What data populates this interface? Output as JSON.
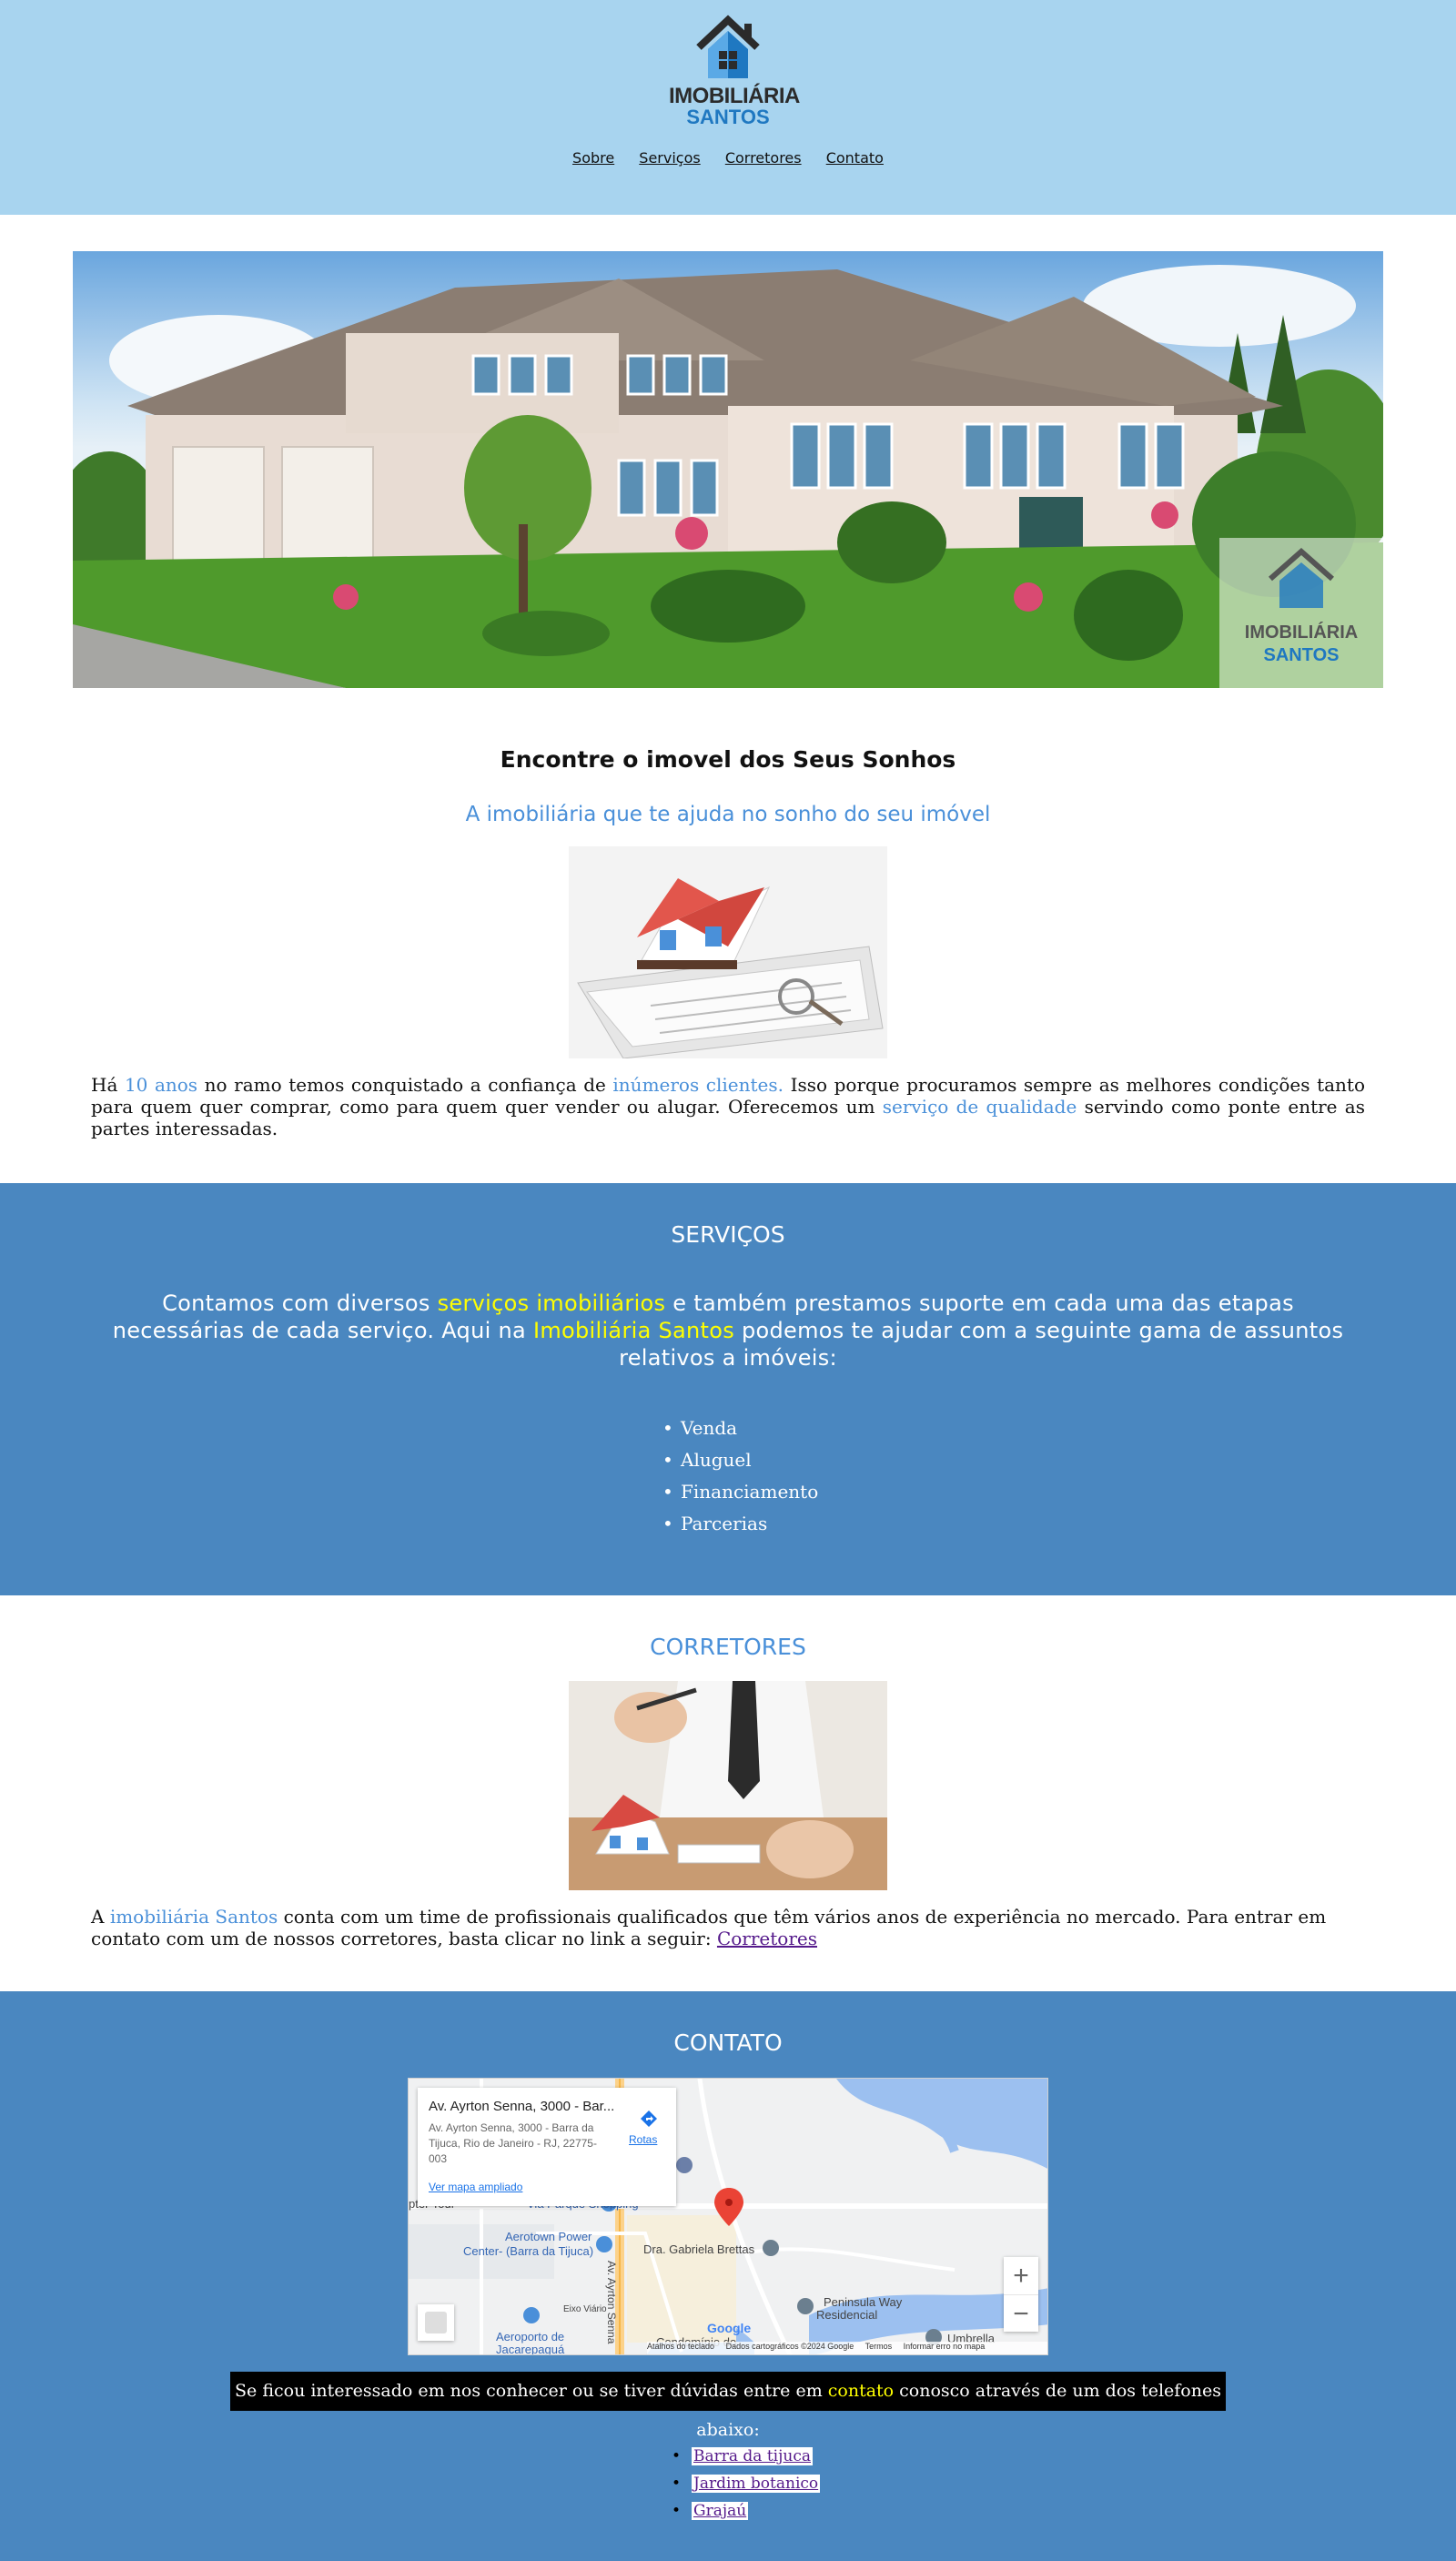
{
  "logo": {
    "line1": "IMOBILIÁRIA",
    "line2": "SANTOS",
    "icon": "house-logo-icon"
  },
  "nav": [
    "Sobre",
    "Serviços",
    "Corretores",
    "Contato"
  ],
  "hero": {
    "alt_watermark": {
      "line1": "IMOBILIÁRIA",
      "line2": "SANTOS"
    }
  },
  "about": {
    "title": "Encontre o imovel dos Seus Sonhos",
    "subtitle": "A imobiliária que te ajuda no sonho do seu imóvel",
    "text": {
      "p1": "Há ",
      "h1": "10 anos",
      "p2": " no ramo temos conquistado a confiança de ",
      "h2": "inúmeros clientes.",
      "p3": " Isso porque procuramos sempre as melhores condições tanto para quem quer comprar, como para quem quer vender ou alugar. Oferecemos um ",
      "h3": "serviço de qualidade",
      "p4": " servindo como ponte entre as partes interessadas."
    }
  },
  "services": {
    "title": "SERVIÇOS",
    "text": {
      "p1": "Contamos com diversos ",
      "h1": "serviços imobiliários",
      "p2": " e também prestamos suporte em cada uma das etapas necessárias de cada serviço. Aqui na ",
      "h2": "Imobiliária Santos",
      "p3": " podemos te ajudar com a seguinte gama de assuntos relativos a imóveis:"
    },
    "items": [
      "Venda",
      "Aluguel",
      "Financiamento",
      "Parcerias"
    ]
  },
  "brokers": {
    "title": "CORRETORES",
    "text": {
      "p1": "A ",
      "h1": "imobiliária Santos",
      "p2": " conta com um time de profissionais qualificados que têm vários anos de experiência no mercado. Para entrar em contato com um de nossos corretores, basta clicar no link a seguir: ",
      "link": "Corretores"
    }
  },
  "contact": {
    "title": "CONTATO",
    "map": {
      "card_title": "Av. Ayrton Senna, 3000 - Bar...",
      "card_address": "Av. Ayrton Senna, 3000 - Barra da Tijuca, Rio de Janeiro - RJ, 22775-003",
      "card_link": "Ver mapa ampliado",
      "route_label": "Rotas",
      "labels": {
        "shopping": "Via Parque Shopping",
        "aerotown": "Aerotown Power",
        "aerotown2": "Center- (Barra da Tijuca)",
        "tour": "pter Tour",
        "gabriela": "Dra. Gabriela Brettas",
        "avenue": "Av. Ayrton Senna",
        "peninsula": "Peninsula Way",
        "peninsula2": "Residencial",
        "airport": "Aeroporto de",
        "airport2": "Jacarepaguá",
        "eixo": "Eixo Viário",
        "umbrella": "Umbrella",
        "condominio": "Condomínio do"
      },
      "footer": [
        "Atalhos do teclado",
        "Dados cartográficos ©2024 Google",
        "Termos",
        "Informar erro no mapa"
      ],
      "google": "Google"
    },
    "bar": {
      "p1": "Se ficou interessado em nos conhecer ou se tiver dúvidas entre em ",
      "h1": "contato",
      "p2": " conosco através de um dos telefones abaixo:"
    },
    "phones": [
      "Barra da tijuca",
      "Jardim botanico",
      "Grajaú"
    ]
  }
}
